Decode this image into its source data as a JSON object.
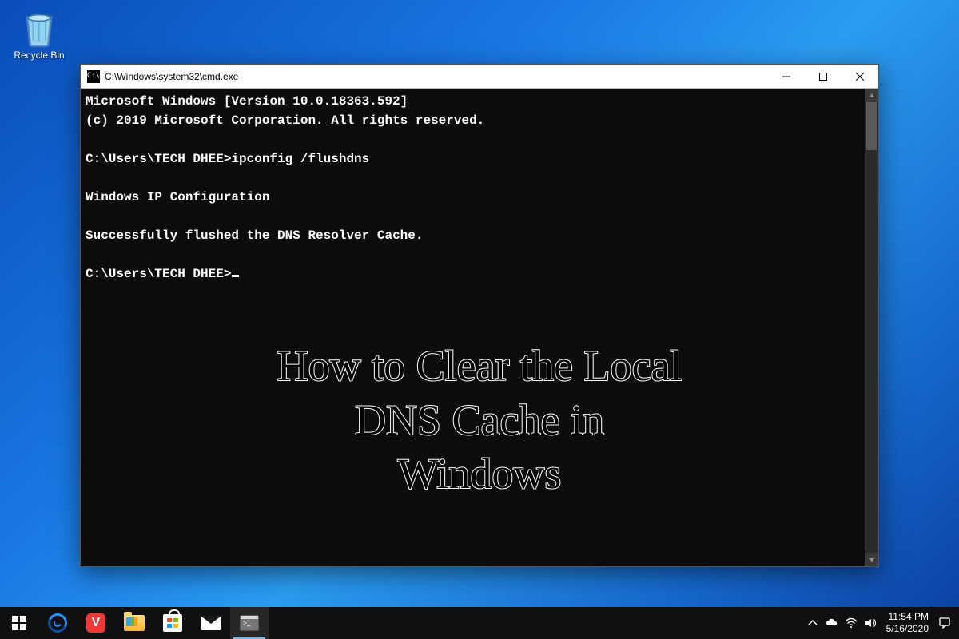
{
  "desktop": {
    "recycle_bin_label": "Recycle Bin"
  },
  "cmd": {
    "title": "C:\\Windows\\system32\\cmd.exe",
    "lines": {
      "l1": "Microsoft Windows [Version 10.0.18363.592]",
      "l2": "(c) 2019 Microsoft Corporation. All rights reserved.",
      "l3": "",
      "l4": "C:\\Users\\TECH DHEE>ipconfig /flushdns",
      "l5": "",
      "l6": "Windows IP Configuration",
      "l7": "",
      "l8": "Successfully flushed the DNS Resolver Cache.",
      "l9": "",
      "l10": "C:\\Users\\TECH DHEE>"
    }
  },
  "overlay": {
    "line1": "How to Clear the Local",
    "line2": "DNS Cache in",
    "line3": "Windows"
  },
  "taskbar": {
    "time": "11:54 PM",
    "date": "5/16/2020"
  }
}
